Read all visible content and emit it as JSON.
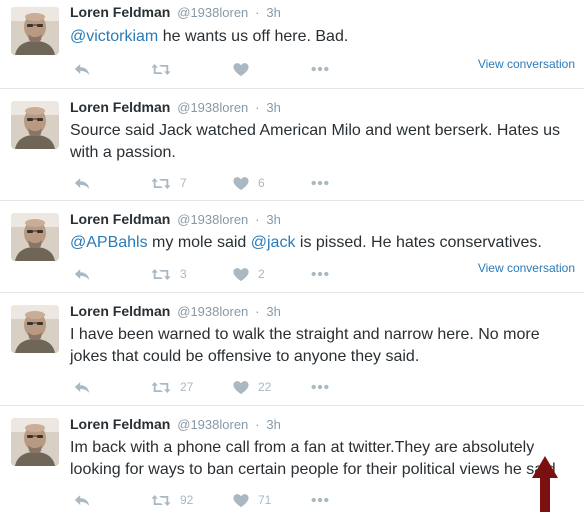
{
  "tweets": [
    {
      "fullname": "Loren Feldman",
      "handle": "@1938loren",
      "separator": "·",
      "time": "3h",
      "mention": "@victorkiam",
      "text_after": " he wants us off here. Bad.",
      "retweets": "",
      "likes": "",
      "view_conversation": "View conversation"
    },
    {
      "fullname": "Loren Feldman",
      "handle": "@1938loren",
      "separator": "·",
      "time": "3h",
      "text": "Source said Jack watched  American Milo and went berserk. Hates us with a passion.",
      "retweets": "7",
      "likes": "6"
    },
    {
      "fullname": "Loren Feldman",
      "handle": "@1938loren",
      "separator": "·",
      "time": "3h",
      "mention": "@APBahls",
      "text_mid": " my mole said ",
      "mention2": "@jack",
      "text_after": " is pissed. He hates conservatives.",
      "retweets": "3",
      "likes": "2",
      "view_conversation": "View conversation"
    },
    {
      "fullname": "Loren Feldman",
      "handle": "@1938loren",
      "separator": "·",
      "time": "3h",
      "text": "I have been warned to walk the straight and narrow here. No more jokes that could be offensive to anyone they said.",
      "retweets": "27",
      "likes": "22"
    },
    {
      "fullname": "Loren Feldman",
      "handle": "@1938loren",
      "separator": "·",
      "time": "3h",
      "text": "Im back with a phone call from a fan at twitter.They are absolutely looking for ways to ban certain people for their political views he said",
      "retweets": "92",
      "likes": "71"
    }
  ],
  "icons": {
    "reply": "reply-icon",
    "retweet": "retweet-icon",
    "like": "heart-icon",
    "more": "more-icon",
    "annotation": "up-arrow-icon"
  },
  "colors": {
    "link": "#2b7bb9",
    "icon": "#aab8c2",
    "meta": "#8899a6",
    "annotation_arrow": "#7a1010"
  }
}
